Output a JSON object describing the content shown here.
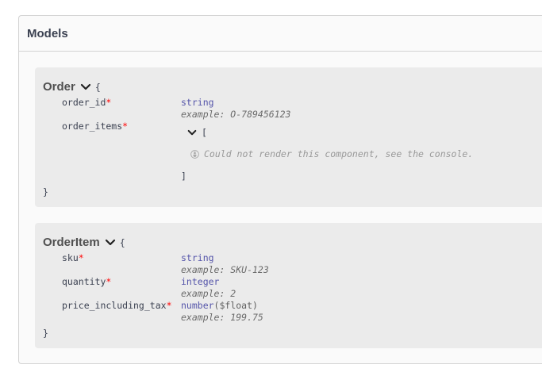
{
  "models": {
    "title": "Models",
    "order": {
      "name": "Order",
      "open_brace": "{",
      "close_brace": "}",
      "props": {
        "order_id": {
          "name": "order_id",
          "required": "*",
          "type": "string",
          "example": "example: O-789456123"
        },
        "order_items": {
          "name": "order_items",
          "required": "*",
          "open_bracket": "[",
          "close_bracket": "]",
          "error": "Could not render this component, see the console."
        }
      }
    },
    "order_item": {
      "name": "OrderItem",
      "open_brace": "{",
      "close_brace": "}",
      "props": {
        "sku": {
          "name": "sku",
          "required": "*",
          "type": "string",
          "example": "example: SKU-123"
        },
        "quantity": {
          "name": "quantity",
          "required": "*",
          "type": "integer",
          "example": "example: 2"
        },
        "price": {
          "name": "price_including_tax",
          "required": "*",
          "type": "number",
          "format": "($float)",
          "example": "example: 199.75"
        }
      }
    },
    "icons": [
      "chevron-down-icon",
      "bug-icon"
    ]
  }
}
